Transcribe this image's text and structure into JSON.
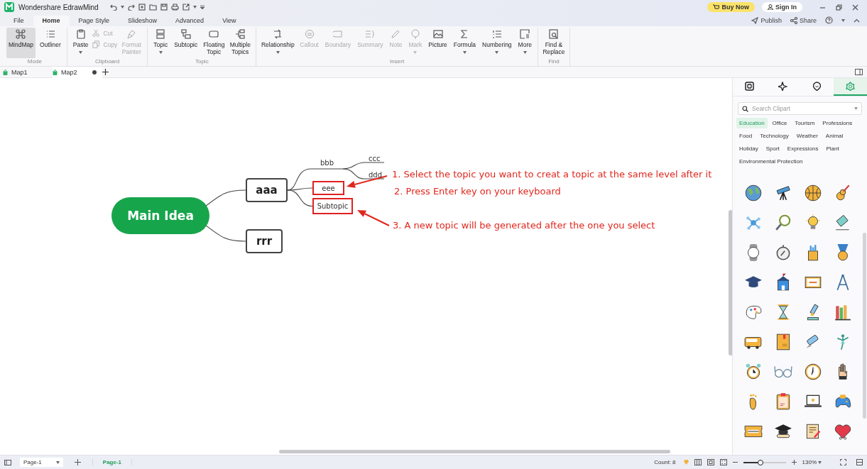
{
  "app": {
    "title": "Wondershare EdrawMind"
  },
  "title_bar": {
    "buy_now": "Buy Now",
    "sign_in": "Sign In"
  },
  "menu_tabs": [
    {
      "label": "File",
      "selected": false
    },
    {
      "label": "Home",
      "selected": true
    },
    {
      "label": "Page Style",
      "selected": false
    },
    {
      "label": "Slideshow",
      "selected": false
    },
    {
      "label": "Advanced",
      "selected": false
    },
    {
      "label": "View",
      "selected": false
    }
  ],
  "header_actions": [
    {
      "label": "Publish"
    },
    {
      "label": "Share"
    }
  ],
  "ribbon": {
    "groups": [
      {
        "label": "Mode",
        "buttons": [
          {
            "kind": "large",
            "label": "MindMap",
            "selected": true,
            "disabled": false,
            "dropdown": false
          },
          {
            "kind": "large",
            "label": "Outliner",
            "selected": false,
            "disabled": false,
            "dropdown": false
          }
        ]
      },
      {
        "label": "Clipboard",
        "buttons": [
          {
            "kind": "large",
            "label": "Paste",
            "selected": false,
            "disabled": false,
            "dropdown": true
          },
          {
            "kind": "small",
            "label": "Cut",
            "disabled": true
          },
          {
            "kind": "small",
            "label": "Copy",
            "disabled": true
          },
          {
            "kind": "large",
            "label": "Format Painter",
            "selected": false,
            "disabled": true,
            "dropdown": false
          }
        ]
      },
      {
        "label": "Topic",
        "buttons": [
          {
            "kind": "large",
            "label": "Topic",
            "selected": false,
            "disabled": false,
            "dropdown": true
          },
          {
            "kind": "large",
            "label": "Subtopic",
            "selected": false,
            "disabled": false,
            "dropdown": false
          },
          {
            "kind": "large",
            "label": "Floating Topic",
            "selected": false,
            "disabled": false,
            "dropdown": false
          },
          {
            "kind": "large",
            "label": "Multiple Topics",
            "selected": false,
            "disabled": false,
            "dropdown": false
          }
        ]
      },
      {
        "label": "Insert",
        "buttons": [
          {
            "kind": "large",
            "label": "Relationship",
            "selected": false,
            "disabled": false,
            "dropdown": true
          },
          {
            "kind": "large",
            "label": "Callout",
            "selected": false,
            "disabled": true,
            "dropdown": false
          },
          {
            "kind": "large",
            "label": "Boundary",
            "selected": false,
            "disabled": true,
            "dropdown": false
          },
          {
            "kind": "large",
            "label": "Summary",
            "selected": false,
            "disabled": true,
            "dropdown": false
          },
          {
            "kind": "large",
            "label": "Note",
            "selected": false,
            "disabled": true,
            "dropdown": false
          },
          {
            "kind": "large",
            "label": "Mark",
            "selected": false,
            "disabled": true,
            "dropdown": true
          },
          {
            "kind": "large",
            "label": "Picture",
            "selected": false,
            "disabled": false,
            "dropdown": false
          },
          {
            "kind": "large",
            "label": "Formula",
            "selected": false,
            "disabled": false,
            "dropdown": true
          },
          {
            "kind": "large",
            "label": "Numbering",
            "selected": false,
            "disabled": false,
            "dropdown": true
          },
          {
            "kind": "large",
            "label": "More",
            "selected": false,
            "disabled": false,
            "dropdown": true
          }
        ]
      },
      {
        "label": "Find",
        "buttons": [
          {
            "kind": "large",
            "label": "Find & Replace",
            "selected": false,
            "disabled": false,
            "dropdown": false
          }
        ]
      }
    ]
  },
  "document_tabs": [
    {
      "label": "Map1",
      "selected": false,
      "modified": false
    },
    {
      "label": "Map2",
      "selected": true,
      "modified": true
    }
  ],
  "mind_map": {
    "central": "Main Idea",
    "topics": [
      {
        "label": "aaa",
        "highlighted": false,
        "children": [
          {
            "label": "bbb",
            "highlighted": false,
            "children": [
              {
                "label": "ccc",
                "highlighted": false
              },
              {
                "label": "ddd",
                "highlighted": false
              }
            ]
          },
          {
            "label": "eee",
            "highlighted": true
          },
          {
            "label": "Subtopic",
            "highlighted": true
          }
        ]
      },
      {
        "label": "rrr",
        "highlighted": false
      }
    ]
  },
  "annotations": [
    {
      "text": "1. Select the topic you want to creat a topic at the same level after it",
      "arrow": true
    },
    {
      "text": "2. Press Enter key on your keyboard",
      "arrow": false
    },
    {
      "text": "3. A new topic will be generated after the one you select",
      "arrow": true
    }
  ],
  "side_panel": {
    "tabs": [
      {
        "selected": false
      },
      {
        "selected": false
      },
      {
        "selected": false
      },
      {
        "selected": true
      }
    ],
    "search": {
      "placeholder": "Search Clipart"
    },
    "categories": [
      {
        "label": "Education",
        "selected": true
      },
      {
        "label": "Office",
        "selected": false
      },
      {
        "label": "Tourism",
        "selected": false
      },
      {
        "label": "Professions",
        "selected": false
      },
      {
        "label": "Food",
        "selected": false
      },
      {
        "label": "Technology",
        "selected": false
      },
      {
        "label": "Weather",
        "selected": false
      },
      {
        "label": "Animal",
        "selected": false
      },
      {
        "label": "Holiday",
        "selected": false
      },
      {
        "label": "Sport",
        "selected": false
      },
      {
        "label": "Expressions",
        "selected": false
      },
      {
        "label": "Plant",
        "selected": false
      },
      {
        "label": "Environmental Protection",
        "selected": false
      }
    ]
  },
  "status_bar": {
    "page_selector": "Page-1",
    "pages": [
      {
        "label": "Page-1",
        "selected": true
      }
    ],
    "count": "Count: 8",
    "zoom": {
      "level": 0.4,
      "reading": "130%"
    }
  }
}
